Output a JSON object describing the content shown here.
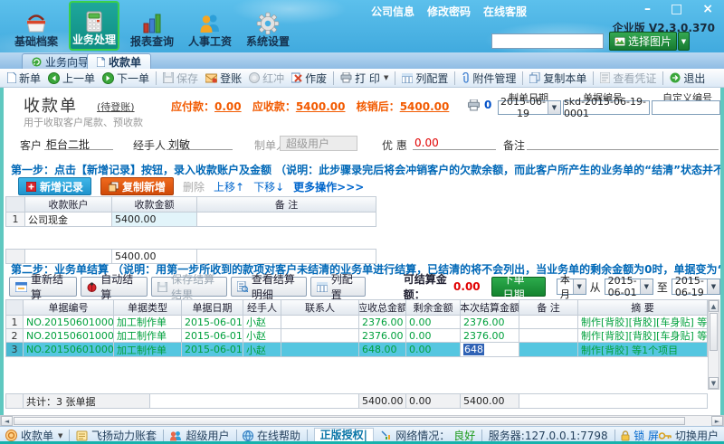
{
  "titlebar": {
    "links": [
      "公司信息",
      "修改密码",
      "在线客服"
    ],
    "window_buttons": {
      "min": "–",
      "max": "□",
      "close": "×"
    },
    "edition": "企业版 V2.3.0.370",
    "image_button": "选择图片",
    "nav": [
      {
        "label": "基础档案"
      },
      {
        "label": "业务处理"
      },
      {
        "label": "报表查询"
      },
      {
        "label": "人事工资"
      },
      {
        "label": "系统设置"
      }
    ]
  },
  "tabs": {
    "wizard": "业务向导",
    "receipt": "收款单"
  },
  "toolbar": {
    "new": "新单",
    "prev": "上一单",
    "next": "下一单",
    "save": "保存",
    "post": "登账",
    "flush": "红冲",
    "void": "作废",
    "print": "打 印",
    "cols": "列配置",
    "attach": "附件管理",
    "copy": "复制本单",
    "voucher": "查看凭证",
    "exit": "退出"
  },
  "doc": {
    "title": "收款单",
    "status": "(待登账)",
    "subtitle": "用于收取客户尾款、预收款",
    "amounts": {
      "payable_label": "应付款：",
      "payable": "0.00",
      "receivable_label": "应收款：",
      "receivable": "5400.00",
      "written_label": "核销后：",
      "written": "5400.00"
    },
    "print_count": "0",
    "fields": {
      "date_label": "制单日期",
      "date": "2015-06-19",
      "no_label": "单据编号",
      "no": "skd-2015-06-19-0001",
      "custom_label": "自定义编号",
      "custom": ""
    }
  },
  "form": {
    "customer_label": "客户",
    "customer": "柜台二批",
    "handler_label": "经手人",
    "handler": "刘敏",
    "creator_label": "制单人",
    "creator": "超级用户",
    "discount_label": "优 惠",
    "discount": "0.00",
    "remark_label": "备注",
    "remark": ""
  },
  "step1": {
    "text": "第一步：点击【新增记录】按钮，录入收款账户及金额 （说明：此步骤录完后将会冲销客户的欠款余额，而此客户所产生的业务单的“结清”状态并不会受影响）",
    "add": "新增记录",
    "copy": "复制新增",
    "del": "删除",
    "up": "上移↑",
    "down": "下移↓",
    "more": "更多操作>>>"
  },
  "account_table": {
    "headers": {
      "account": "收款账户",
      "amount": "收款金额",
      "remark": "备 注"
    },
    "rows": [
      {
        "no": "1",
        "account": "公司现金",
        "amount": "5400.00",
        "remark": ""
      }
    ],
    "total": "5400.00"
  },
  "step2": {
    "text": "第二步：业务单结算 （说明：用第一步所收到的款项对客户未结清的业务单进行结算，已结清的将不会列出，当业务单的剩余金额为0时，单据变为“已结清”状态。当下表为空或收款单作为预收用途时可省略此"
  },
  "settle": {
    "recalc": "重新结算",
    "auto": "自动结算",
    "save": "保存结算结果",
    "detail": "查看结算明细",
    "cols": "列配置",
    "amount_label": "可结算金额：",
    "amount": "0.00",
    "order_btn": "下单日期",
    "period": "本月",
    "from_label": "从",
    "from": "2015-06-01",
    "to_label": "至",
    "to": "2015-06-19"
  },
  "orders": {
    "headers": {
      "code": "单据编号",
      "type": "单据类型",
      "date": "单据日期",
      "handler": "经手人",
      "contact": "联系人",
      "total": "应收总金额",
      "remain": "剩余金额",
      "settle": "本次结算金额",
      "remark": "备 注",
      "summary": "摘 要"
    },
    "rows": [
      {
        "no": "1",
        "code": "NO.201506010003",
        "type": "加工制作单",
        "date": "2015-06-01",
        "handler": "小赵",
        "contact": "",
        "total": "2376.00",
        "remain": "0.00",
        "settle": "2376.00",
        "remark": "",
        "summary": "制作[背胶][背胶][车身贴] 等5个项目"
      },
      {
        "no": "2",
        "code": "NO.201506010004",
        "type": "加工制作单",
        "date": "2015-06-01",
        "handler": "小赵",
        "contact": "",
        "total": "2376.00",
        "remain": "0.00",
        "settle": "2376.00",
        "remark": "",
        "summary": "制作[背胶][背胶][车身贴] 等5个项目"
      },
      {
        "no": "3",
        "code": "NO.201506010006",
        "type": "加工制作单",
        "date": "2015-06-01",
        "handler": "小赵",
        "contact": "",
        "total": "648.00",
        "remain": "0.00",
        "settle": "648",
        "remark": "",
        "summary": "制作[背胶] 等1个项目"
      }
    ],
    "totals": {
      "label": "共计：3 张单据",
      "total": "5400.00",
      "remain": "0.00",
      "settle": "5400.00"
    }
  },
  "statusbar": {
    "doc": "收款单",
    "account_set": "飞扬动力账套",
    "user": "超级用户",
    "help": "在线帮助",
    "license": "正版授权|终身使用",
    "network_label": "网络情况：",
    "network": "良好",
    "server": "服务器:127.0.0.1:7798",
    "lock": "锁 屏",
    "switch": "切换用户"
  }
}
